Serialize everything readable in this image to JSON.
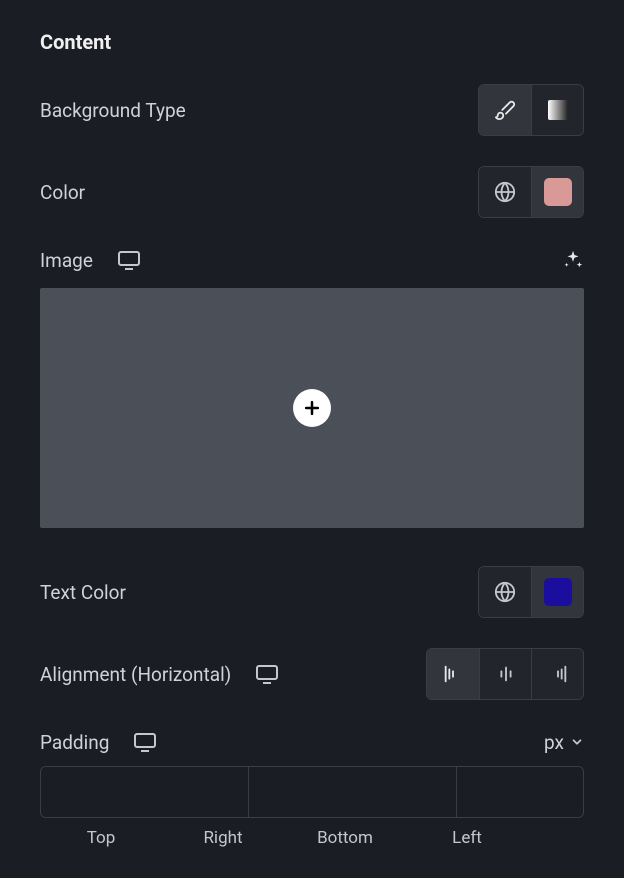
{
  "section": {
    "title": "Content"
  },
  "backgroundType": {
    "label": "Background Type",
    "options": [
      "classic",
      "gradient"
    ],
    "selected": "classic"
  },
  "color": {
    "label": "Color",
    "value": "#d99a97"
  },
  "image": {
    "label": "Image",
    "value": null
  },
  "textColor": {
    "label": "Text Color",
    "value": "#1b0e9e"
  },
  "alignment": {
    "label": "Alignment (Horizontal)",
    "options": [
      "left",
      "center",
      "right"
    ],
    "selected": "left"
  },
  "padding": {
    "label": "Padding",
    "unit": "px",
    "labels": {
      "top": "Top",
      "right": "Right",
      "bottom": "Bottom",
      "left": "Left"
    },
    "values": {
      "top": "",
      "right": "",
      "bottom": "",
      "left": ""
    },
    "linked": true
  }
}
